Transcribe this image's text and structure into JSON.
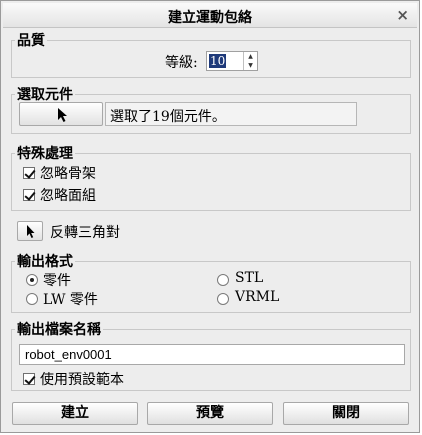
{
  "window": {
    "title": "建立運動包絡",
    "close_glyph": "×"
  },
  "quality": {
    "group_label": "品質",
    "level_label": "等級:",
    "level_value": "10"
  },
  "selection": {
    "group_label": "選取元件",
    "status_text": "選取了19個元件。"
  },
  "special": {
    "group_label": "特殊處理",
    "ignore_skeleton": {
      "label": "忽略骨架",
      "checked": true
    },
    "ignore_quilts": {
      "label": "忽略面組",
      "checked": true
    }
  },
  "flip": {
    "label": "反轉三角對"
  },
  "output_format": {
    "group_label": "輸出格式",
    "options": [
      {
        "label": "零件",
        "selected": true
      },
      {
        "label": "STL",
        "selected": false
      },
      {
        "label": "LW 零件",
        "selected": false
      },
      {
        "label": "VRML",
        "selected": false
      }
    ]
  },
  "output_name": {
    "group_label": "輸出檔案名稱",
    "value": "robot_env0001",
    "use_default_template": {
      "label": "使用預設範本",
      "checked": true
    }
  },
  "buttons": {
    "create": "建立",
    "preview": "預覽",
    "close": "關閉"
  }
}
